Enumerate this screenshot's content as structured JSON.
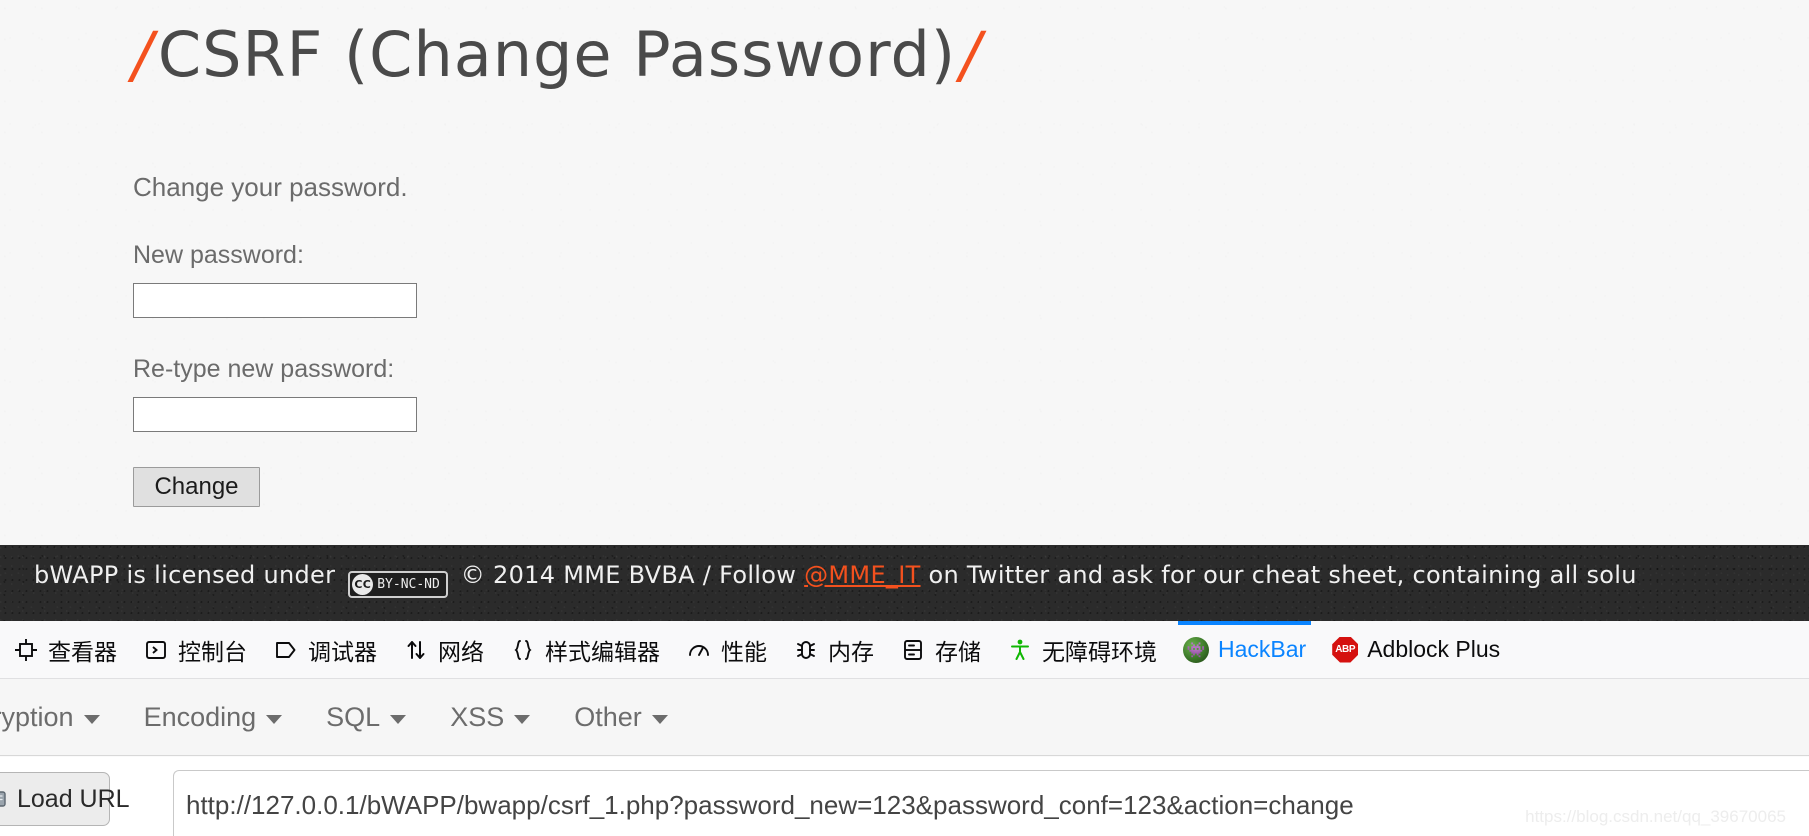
{
  "page": {
    "title_slash_left": "/",
    "title": "CSRF (Change Password)",
    "title_slash_right": "/",
    "intro": "Change your password.",
    "form": {
      "new_password_label": "New password:",
      "new_password_value": "",
      "retype_password_label": "Re-type new password:",
      "retype_password_value": "",
      "submit_label": "Change"
    }
  },
  "footer": {
    "text_before_badge": "bWAPP is licensed under",
    "cc_mark": "CC",
    "cc_terms": "BY-NC-ND",
    "text_after_badge": "© 2014 MME BVBA / Follow",
    "twitter_handle": "@MME_IT",
    "text_tail": "on Twitter and ask for our cheat sheet, containing all solu"
  },
  "devtools": {
    "tabs": [
      {
        "label": "查看器",
        "icon": "inspector-icon",
        "active": false
      },
      {
        "label": "控制台",
        "icon": "console-icon",
        "active": false
      },
      {
        "label": "调试器",
        "icon": "debugger-icon",
        "active": false
      },
      {
        "label": "网络",
        "icon": "network-icon",
        "active": false
      },
      {
        "label": "样式编辑器",
        "icon": "style-editor-icon",
        "active": false
      },
      {
        "label": "性能",
        "icon": "performance-icon",
        "active": false
      },
      {
        "label": "内存",
        "icon": "memory-icon",
        "active": false
      },
      {
        "label": "存储",
        "icon": "storage-icon",
        "active": false
      },
      {
        "label": "无障碍环境",
        "icon": "accessibility-icon",
        "active": false
      },
      {
        "label": "HackBar",
        "icon": "hackbar-icon",
        "active": true
      },
      {
        "label": "Adblock Plus",
        "icon": "adblock-plus-icon",
        "active": false
      }
    ]
  },
  "hackbar": {
    "menu": [
      {
        "label": "ncryption"
      },
      {
        "label": "Encoding"
      },
      {
        "label": "SQL"
      },
      {
        "label": "XSS"
      },
      {
        "label": "Other"
      }
    ],
    "load_url_label": "Load URL",
    "url_value": "http://127.0.0.1/bWAPP/bwapp/csrf_1.php?password_new=123&password_conf=123&action=change"
  },
  "watermark": "https://blog.csdn.net/qq_39670065",
  "colors": {
    "accent_orange": "#f4511e",
    "accent_blue": "#0a84ff",
    "footer_bg": "#2b2b2b",
    "page_bg": "#f7f7f7",
    "accessibility_green": "#10b703",
    "adblock_red": "#d5110f"
  }
}
